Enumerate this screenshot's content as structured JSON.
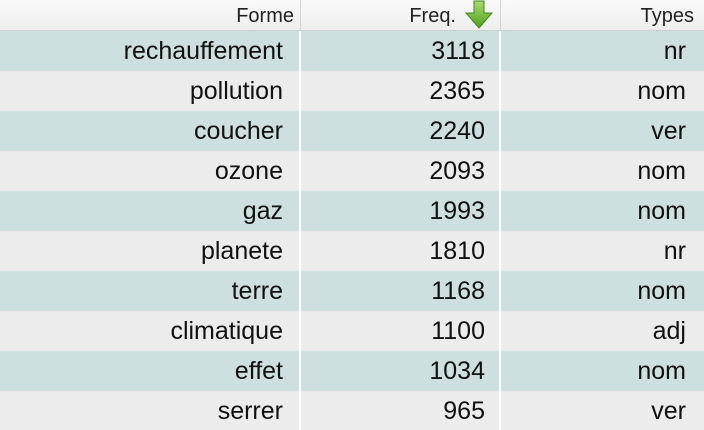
{
  "columns": {
    "forme": "Forme",
    "freq": "Freq.",
    "types": "Types"
  },
  "sort": {
    "column": "freq",
    "direction": "descending",
    "icon": "sort-down-arrow-icon",
    "color": "#7cc242"
  },
  "colors": {
    "row_odd": "#cde0df",
    "row_even": "#ececec"
  },
  "rows": [
    {
      "forme": "rechauffement",
      "freq": "3118",
      "types": "nr"
    },
    {
      "forme": "pollution",
      "freq": "2365",
      "types": "nom"
    },
    {
      "forme": "coucher",
      "freq": "2240",
      "types": "ver"
    },
    {
      "forme": "ozone",
      "freq": "2093",
      "types": "nom"
    },
    {
      "forme": "gaz",
      "freq": "1993",
      "types": "nom"
    },
    {
      "forme": "planete",
      "freq": "1810",
      "types": "nr"
    },
    {
      "forme": "terre",
      "freq": "1168",
      "types": "nom"
    },
    {
      "forme": "climatique",
      "freq": "1100",
      "types": "adj"
    },
    {
      "forme": "effet",
      "freq": "1034",
      "types": "nom"
    },
    {
      "forme": "serrer",
      "freq": "965",
      "types": "ver"
    }
  ]
}
